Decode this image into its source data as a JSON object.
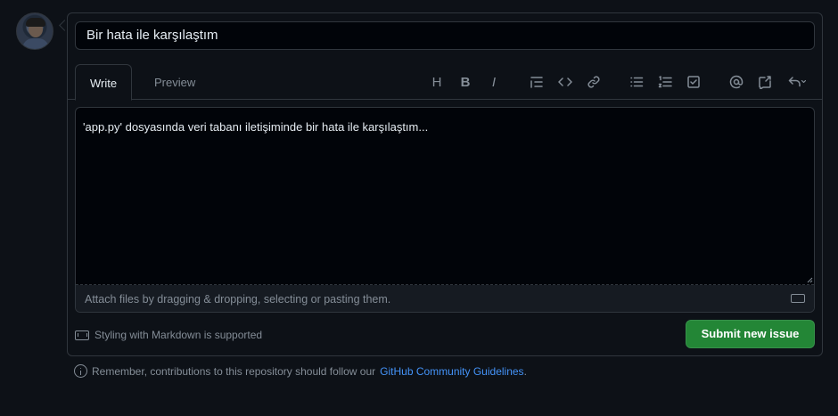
{
  "issue_form": {
    "title_value": "Bir hata ile karşılaştım",
    "tabs": [
      {
        "label": "Write",
        "active": true
      },
      {
        "label": "Preview",
        "active": false
      }
    ],
    "toolbar": {
      "heading": "H",
      "bold": "B",
      "italic": "I",
      "icons": [
        "heading-icon",
        "bold-icon",
        "italic-icon",
        "quote-icon",
        "code-icon",
        "link-icon",
        "unordered-list-icon",
        "ordered-list-icon",
        "task-list-icon",
        "mention-icon",
        "reference-icon",
        "reply-icon"
      ]
    },
    "body_value": "'app.py' dosyasında veri tabanı iletişiminde bir hata ile karşılaştım...",
    "attach_hint": "Attach files by dragging & dropping, selecting or pasting them.",
    "markdown_note": "Styling with Markdown is supported",
    "submit_label": "Submit new issue"
  },
  "footer": {
    "remember_text": "Remember, contributions to this repository should follow our",
    "link_text": "GitHub Community Guidelines",
    "period": "."
  },
  "colors": {
    "background": "#0d1117",
    "border": "#30363d",
    "submit_green": "#238636",
    "link_blue": "#4493f8",
    "muted_text": "#848d97"
  }
}
